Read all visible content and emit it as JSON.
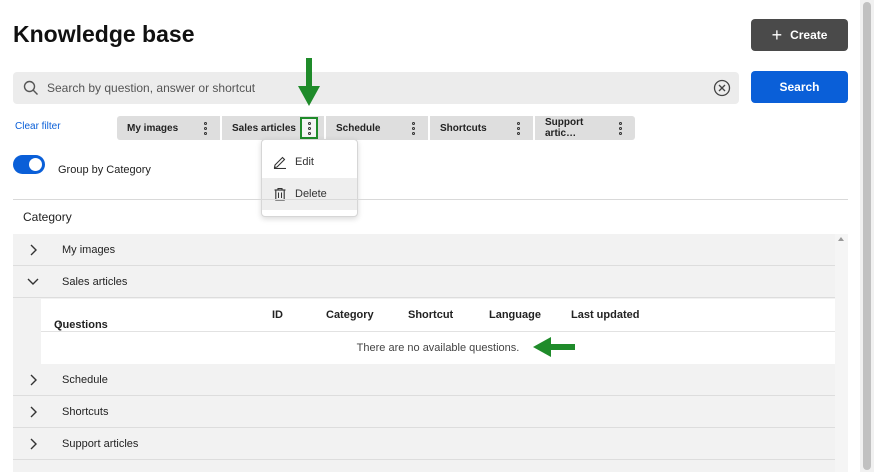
{
  "page": {
    "title": "Knowledge base"
  },
  "toolbar": {
    "create_label": "Create"
  },
  "search": {
    "placeholder": "Search by question, answer or shortcut",
    "value": "",
    "button_label": "Search"
  },
  "filters": {
    "clear_label": "Clear filter",
    "chips": [
      {
        "label": "My images"
      },
      {
        "label": "Sales articles"
      },
      {
        "label": "Schedule"
      },
      {
        "label": "Shortcuts"
      },
      {
        "label": "Support artic…"
      }
    ]
  },
  "context_menu": {
    "edit_label": "Edit",
    "delete_label": "Delete"
  },
  "grouping": {
    "label": "Group by Category",
    "enabled": true
  },
  "category_header": "Category",
  "categories": [
    {
      "label": "My images",
      "expanded": false
    },
    {
      "label": "Sales articles",
      "expanded": true
    },
    {
      "label": "Schedule",
      "expanded": false
    },
    {
      "label": "Shortcuts",
      "expanded": false
    },
    {
      "label": "Support articles",
      "expanded": false
    }
  ],
  "questions_table": {
    "columns": [
      "Questions",
      "ID",
      "Category",
      "Shortcut",
      "Language",
      "Last updated"
    ],
    "sort_indicator": "↑",
    "empty_message": "There are no available questions."
  },
  "colors": {
    "primary": "#0a5fd8",
    "annotation_green": "#1f8b2a",
    "create_button": "#4a4a4a"
  },
  "icons": {
    "create": "plus-icon",
    "search": "search-icon",
    "clear": "clear-circle-x-icon",
    "chip_menu": "kebab-icon",
    "edit": "pencil-icon",
    "delete": "trash-icon",
    "row_collapsed": "chevron-right-icon",
    "row_expanded": "chevron-down-icon"
  }
}
